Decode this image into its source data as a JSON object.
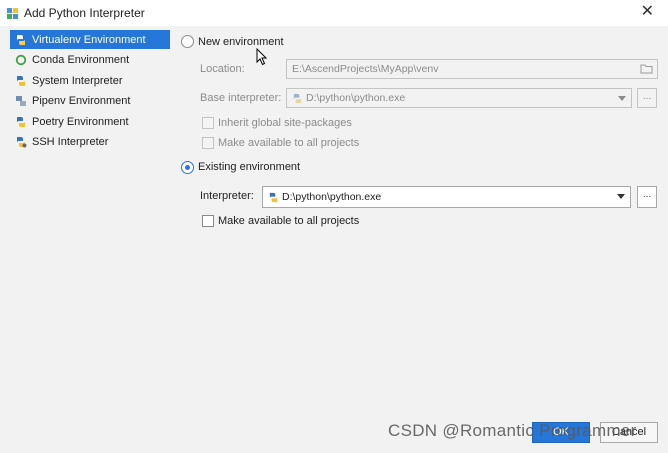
{
  "window": {
    "title": "Add Python Interpreter",
    "close_glyph": "✕"
  },
  "sidebar": {
    "items": [
      {
        "label": "Virtualenv Environment",
        "icon": "virtualenv-icon",
        "selected": true
      },
      {
        "label": "Conda Environment",
        "icon": "conda-icon"
      },
      {
        "label": "System Interpreter",
        "icon": "python-icon"
      },
      {
        "label": "Pipenv Environment",
        "icon": "pipenv-icon"
      },
      {
        "label": "Poetry Environment",
        "icon": "poetry-icon"
      },
      {
        "label": "SSH Interpreter",
        "icon": "ssh-icon"
      }
    ]
  },
  "new_env": {
    "label": "New environment",
    "location_label": "Location:",
    "location_value": "E:\\AscendProjects\\MyApp\\venv",
    "base_label": "Base interpreter:",
    "base_value": "D:\\python\\python.exe",
    "browse_label": "...",
    "inherit_label": "Inherit global site-packages",
    "make_available_label": "Make available to all projects"
  },
  "existing_env": {
    "label": "Existing environment",
    "interpreter_label": "Interpreter:",
    "interpreter_value": "D:\\python\\python.exe",
    "browse_label": "...",
    "make_available_label": "Make available to all projects"
  },
  "footer": {
    "ok_label": "OK",
    "cancel_label": "Cancel"
  },
  "watermark": "CSDN @Romantic Programmer",
  "colors": {
    "accent": "#2675d8",
    "background": "#f2f2f2"
  }
}
